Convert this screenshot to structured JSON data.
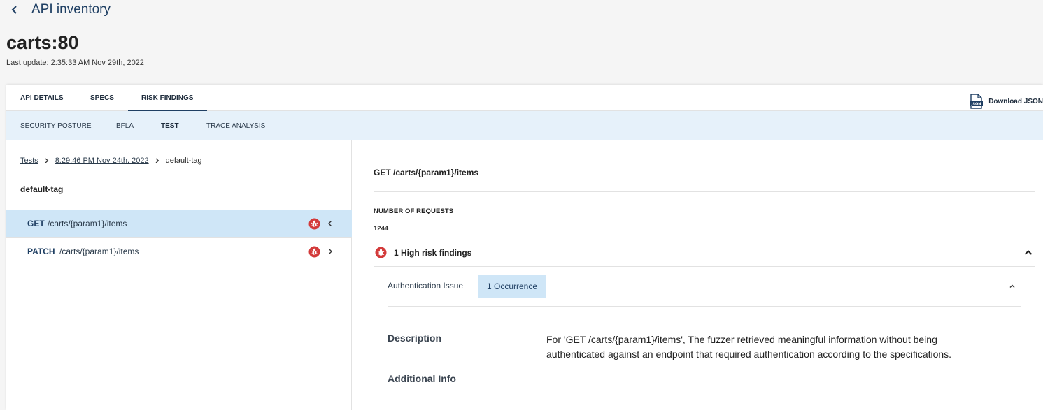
{
  "nav": {
    "title": "API inventory",
    "back_icon": "chevron-left-icon"
  },
  "header": {
    "title": "carts:80",
    "last_update": "Last update: 2:35:33 AM Nov 29th, 2022"
  },
  "tabs": [
    {
      "label": "API DETAILS",
      "active": false
    },
    {
      "label": "SPECS",
      "active": false
    },
    {
      "label": "RISK FINDINGS",
      "active": true
    }
  ],
  "download": {
    "label": "Download JSON",
    "icon": "json-file-icon"
  },
  "subtabs": [
    {
      "label": "SECURITY POSTURE",
      "active": false
    },
    {
      "label": "BFLA",
      "active": false
    },
    {
      "label": "TEST",
      "active": true
    },
    {
      "label": "TRACE ANALYSIS",
      "active": false
    }
  ],
  "breadcrumb": {
    "root": "Tests",
    "date": "8:29:46 PM Nov 24th, 2022",
    "current": "default-tag"
  },
  "tag_title": "default-tag",
  "endpoints": [
    {
      "method": "GET",
      "path": "/carts/{param1}/items",
      "selected": true,
      "status_icon": "bug-icon"
    },
    {
      "method": "PATCH",
      "path": "/carts/{param1}/items",
      "selected": false,
      "status_icon": "bug-icon"
    }
  ],
  "detail": {
    "title": "GET /carts/{param1}/items",
    "requests_label": "NUMBER OF REQUESTS",
    "requests_value": "1244",
    "findings_label": "1 High risk findings",
    "issue": {
      "name": "Authentication Issue",
      "occurrences": "1 Occurrence",
      "description_label": "Description",
      "description": "For 'GET /carts/{param1}/items', The fuzzer retrieved meaningful information without being authenticated against an endpoint that required authentication according to the specifications.",
      "additional_label": "Additional Info"
    }
  },
  "colors": {
    "accent": "#1f3f63",
    "selected_bg": "#cfe6f7",
    "subtab_bg": "#e6f1fa",
    "high_risk": "#d33a3a"
  }
}
